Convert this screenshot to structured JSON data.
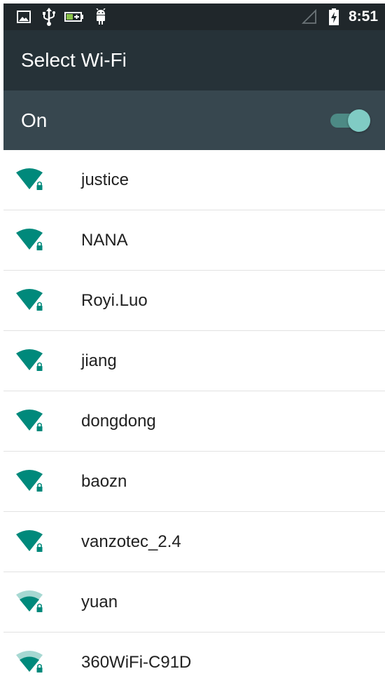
{
  "status_bar": {
    "time": "8:51",
    "icons": [
      "image-icon",
      "usb-icon",
      "battery-saver-icon",
      "android-debug-icon",
      "signal-empty-icon",
      "battery-charging-icon"
    ]
  },
  "app_bar": {
    "title": "Select Wi-Fi"
  },
  "wifi_toggle": {
    "label": "On",
    "enabled": true
  },
  "networks": [
    {
      "ssid": "justice",
      "signal": "full",
      "secured": true
    },
    {
      "ssid": "NANA",
      "signal": "full",
      "secured": true
    },
    {
      "ssid": "Royi.Luo",
      "signal": "full",
      "secured": true
    },
    {
      "ssid": "jiang",
      "signal": "full",
      "secured": true
    },
    {
      "ssid": "dongdong",
      "signal": "full",
      "secured": true
    },
    {
      "ssid": "baozn",
      "signal": "full",
      "secured": true
    },
    {
      "ssid": "vanzotec_2.4",
      "signal": "full",
      "secured": true
    },
    {
      "ssid": "yuan",
      "signal": "medium",
      "secured": true
    },
    {
      "ssid": "360WiFi-C91D",
      "signal": "medium",
      "secured": true
    }
  ],
  "colors": {
    "status_bar": "#20272b",
    "app_bar": "#263238",
    "switch_bar": "#37474f",
    "accent": "#009688",
    "accent_light": "#80cbc4",
    "divider": "#e2e2e2"
  }
}
